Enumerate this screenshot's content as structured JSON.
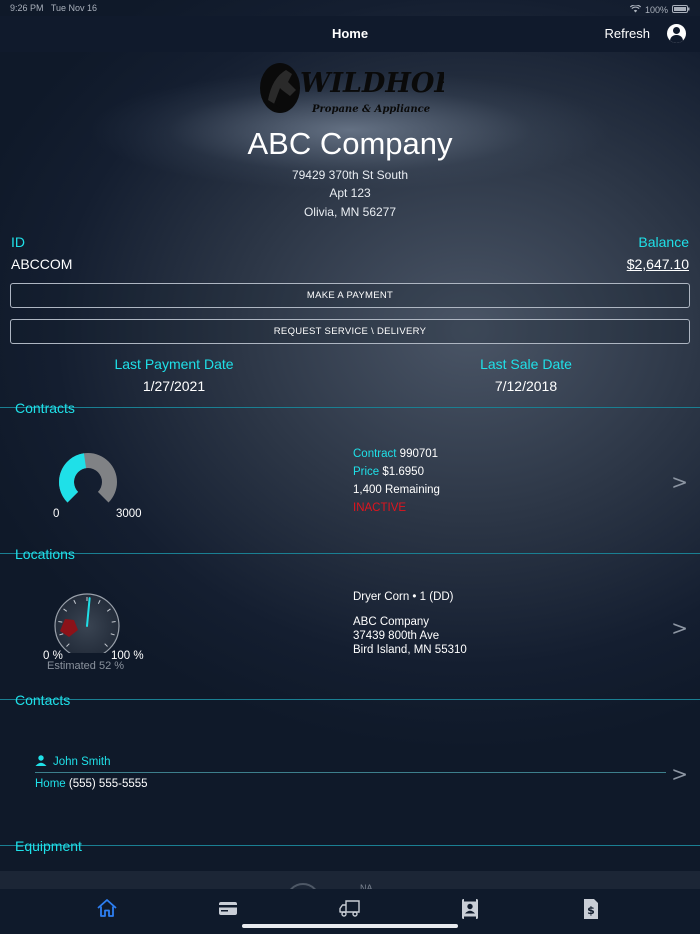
{
  "status_bar": {
    "time": "9:26 PM",
    "date": "Tue Nov 16",
    "battery": "100%"
  },
  "nav": {
    "title": "Home",
    "refresh_label": "Refresh",
    "icons": {
      "user": "person-circle-icon"
    }
  },
  "logo": {
    "brand": "WILDHORSE",
    "tagline": "Propane & Appliance"
  },
  "company": {
    "name": "ABC Company",
    "address_line1": "79429 370th St South",
    "address_line2": "Apt 123",
    "address_line3": "Olivia, MN 56277"
  },
  "account": {
    "id_label": "ID",
    "id_value": "ABCCOM",
    "balance_label": "Balance",
    "balance_value": "$2,647.10"
  },
  "buttons": {
    "make_payment": "MAKE A PAYMENT",
    "request_service": "REQUEST SERVICE \\ DELIVERY"
  },
  "dates": {
    "last_payment_label": "Last Payment Date",
    "last_payment_value": "1/27/2021",
    "last_sale_label": "Last Sale Date",
    "last_sale_value": "7/12/2018"
  },
  "contracts": {
    "title": "Contracts",
    "gauge_min": "0",
    "gauge_max": "3000",
    "gauge_fill_fraction": 0.47,
    "contract_label": "Contract",
    "contract_value": "990701",
    "price_label": "Price",
    "price_value": "$1.6950",
    "remaining": "1,400 Remaining",
    "status": "INACTIVE",
    "chevron": ">"
  },
  "locations": {
    "title": "Locations",
    "gauge_min": "0 %",
    "gauge_max": "100 %",
    "estimated": "Estimated 52 %",
    "estimated_percent": 52,
    "name": "Dryer Corn • 1 (DD)",
    "company": "ABC Company",
    "street": "37439 800th Ave",
    "city": "Bird Island, MN  55310",
    "chevron": ">"
  },
  "contacts": {
    "title": "Contacts",
    "name": "John Smith",
    "phone_label": "Home",
    "phone_value": "(555) 555-5555",
    "chevron": ">"
  },
  "equipment": {
    "title": "Equipment",
    "peek_text": "NA"
  },
  "tabs": [
    {
      "name": "home",
      "icon": "house-icon",
      "active": true
    },
    {
      "name": "payments",
      "icon": "credit-card-icon",
      "active": false
    },
    {
      "name": "delivery",
      "icon": "truck-icon",
      "active": false
    },
    {
      "name": "contacts",
      "icon": "contact-book-icon",
      "active": false
    },
    {
      "name": "invoices",
      "icon": "invoice-dollar-icon",
      "active": false
    }
  ],
  "colors": {
    "accent": "#1fe0e8",
    "status_inactive": "#e0141e",
    "tab_active": "#2d7ff2",
    "tab_inactive": "#c9ced6"
  }
}
